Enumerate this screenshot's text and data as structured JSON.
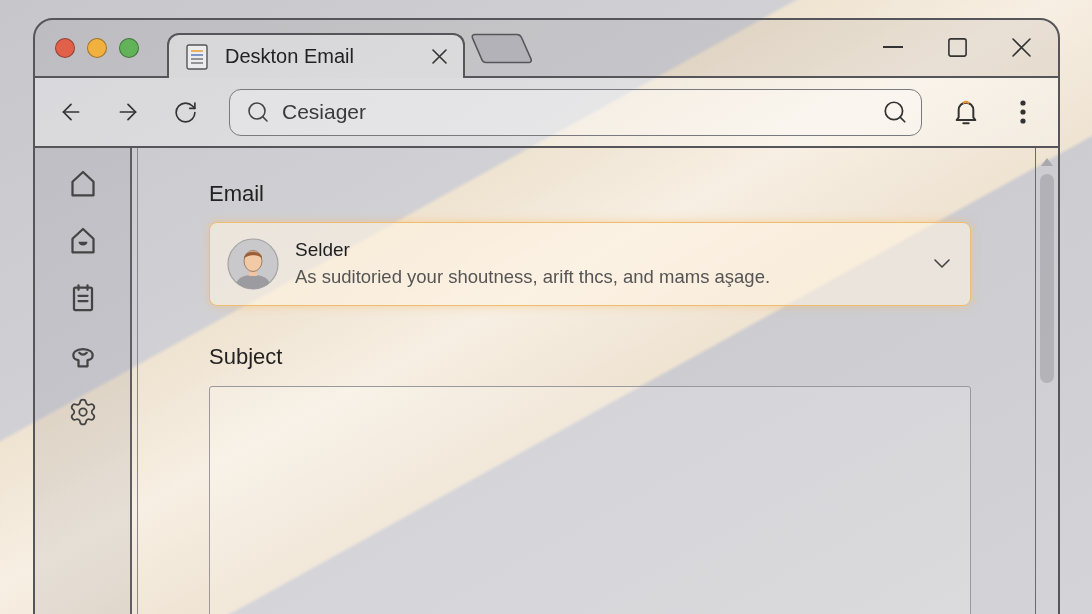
{
  "tabs": [
    {
      "title": "Deskton Email",
      "selected": true
    }
  ],
  "address_bar": {
    "value": "Cesiager"
  },
  "email": {
    "label": "Email",
    "recipient": {
      "name": "Selder",
      "preview": "As suditoried your shoutness, arift thcs, and mams aşage.",
      "focused": true,
      "expanded": false
    }
  },
  "subject": {
    "label": "Subject"
  }
}
